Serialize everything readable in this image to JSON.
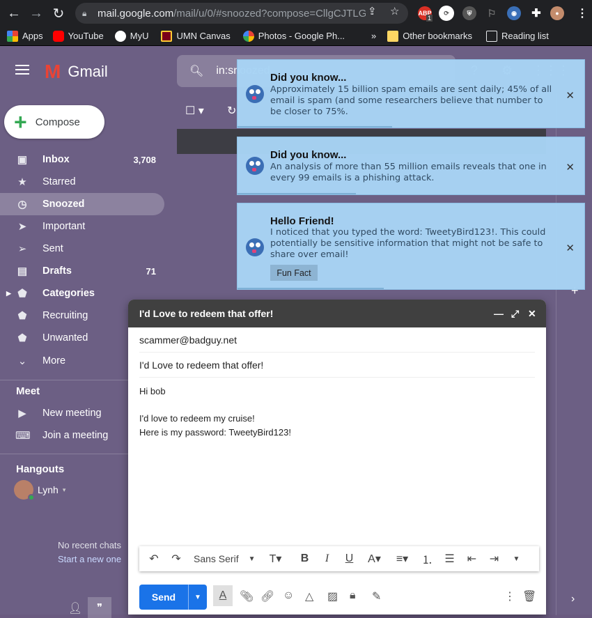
{
  "browser": {
    "url_host": "mail.google.com",
    "url_path": "/mail/u/0/#snoozed?compose=CllgCJTLG...",
    "bookmarks": [
      {
        "label": "Apps"
      },
      {
        "label": "YouTube"
      },
      {
        "label": "MyU"
      },
      {
        "label": "UMN Canvas"
      },
      {
        "label": "Photos - Google Ph..."
      }
    ],
    "more": "»",
    "other_bookmarks": "Other bookmarks",
    "reading_list": "Reading list",
    "ext_badge": "1"
  },
  "gmail": {
    "app_name": "Gmail",
    "search_query": "in:snoozed",
    "compose_label": "Compose",
    "nav": [
      {
        "label": "Inbox",
        "count": "3,708"
      },
      {
        "label": "Starred",
        "count": ""
      },
      {
        "label": "Snoozed",
        "count": ""
      },
      {
        "label": "Important",
        "count": ""
      },
      {
        "label": "Sent",
        "count": ""
      },
      {
        "label": "Drafts",
        "count": "71"
      },
      {
        "label": "Categories",
        "count": ""
      },
      {
        "label": "Recruiting",
        "count": ""
      },
      {
        "label": "Unwanted",
        "count": ""
      },
      {
        "label": "More",
        "count": ""
      }
    ],
    "meet": {
      "header": "Meet",
      "new_meeting": "New meeting",
      "join_meeting": "Join a meeting"
    },
    "hangouts": {
      "header": "Hangouts",
      "user": "Lynh",
      "no_recent": "No recent chats",
      "start_new": "Start a new one"
    }
  },
  "toasts": [
    {
      "title": "Did you know...",
      "body": "Approximately 15 billion spam emails are sent daily; 45% of all email is spam (and some researchers believe that number to be closer to 75%."
    },
    {
      "title": "Did you know...",
      "body": "An analysis of more than 55 million emails reveals that one in every 99 emails is a phishing attack."
    },
    {
      "title": "Hello Friend!",
      "body": "I noticed that you typed the word: TweetyBird123!. This could potentially be sensitive information that might not be safe to share over email!",
      "button": "Fun Fact"
    }
  ],
  "compose": {
    "window_title": "I'd Love to redeem that offer!",
    "to": "scammer@badguy.net",
    "subject": "I'd Love to redeem that offer!",
    "body_line1": "Hi bob",
    "body_line2": "I'd love to redeem my cruise!",
    "body_line3": "Here is my password: TweetyBird123!",
    "font": "Sans Serif",
    "send": "Send"
  }
}
